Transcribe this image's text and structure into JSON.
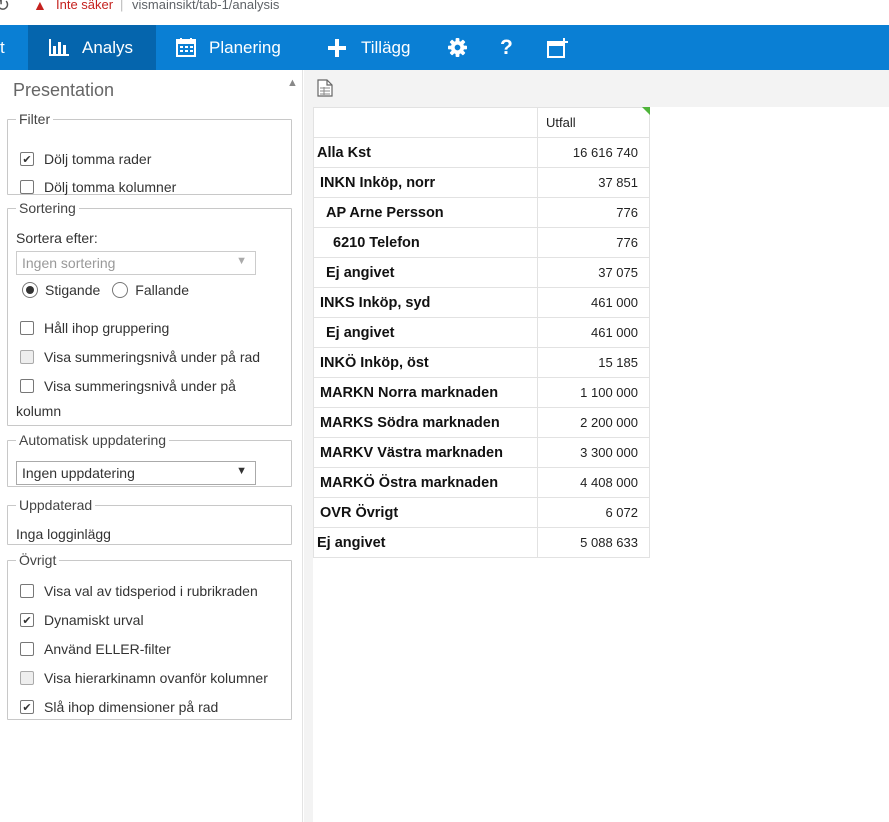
{
  "browser": {
    "security_label": "Inte säker",
    "url": "vismainsikt/tab-1/analysis"
  },
  "nav": {
    "items": [
      {
        "label": "Analys",
        "icon": "bar-chart-icon",
        "active": true
      },
      {
        "label": "Planering",
        "icon": "calendar-icon",
        "active": false
      },
      {
        "label": "Tillägg",
        "icon": "plus-icon",
        "active": false
      }
    ],
    "edge_glyph": "t",
    "icons": [
      "gear-icon",
      "help-icon",
      "add-window-icon"
    ]
  },
  "sidebar": {
    "title": "Presentation",
    "filter": {
      "legend": "Filter",
      "options": [
        {
          "label": "Dölj tomma rader",
          "checked": true
        },
        {
          "label": "Dölj tomma kolumner",
          "checked": false
        }
      ]
    },
    "sorting": {
      "legend": "Sortering",
      "sort_by_label": "Sortera efter:",
      "sort_by_value": "Ingen sortering",
      "radio_ascending": "Stigande",
      "radio_descending": "Fallande",
      "selected": "Stigande",
      "keep_grouping": "Håll ihop gruppering",
      "sum_level_row": "Visa summeringsnivå under på rad",
      "sum_level_column_line1": "Visa summeringsnivå under på",
      "sum_level_column_line2": "kolumn"
    },
    "auto_update": {
      "legend": "Automatisk uppdatering",
      "value": "Ingen uppdatering"
    },
    "updated": {
      "legend": "Uppdaterad",
      "text": "Inga logginlägg"
    },
    "other": {
      "legend": "Övrigt",
      "options": [
        {
          "label": "Visa val av tidsperiod i rubrikraden",
          "checked": false
        },
        {
          "label": "Dynamiskt urval",
          "checked": true
        },
        {
          "label": "Använd ELLER-filter",
          "checked": false
        },
        {
          "label": "Visa hierarkinamn ovanför kolumner",
          "checked": false
        },
        {
          "label": "Slå ihop dimensioner på rad",
          "checked": true
        }
      ]
    }
  },
  "table": {
    "column_header": "Utfall",
    "rows": [
      {
        "label": "Alla Kst",
        "value": "16 616 740",
        "level": 0
      },
      {
        "label": "INKN Inköp, norr",
        "value": "37 851",
        "level": 1
      },
      {
        "label": "AP Arne Persson",
        "value": "776",
        "level": 2
      },
      {
        "label": "6210 Telefon",
        "value": "776",
        "level": 3
      },
      {
        "label": "Ej angivet",
        "value": "37 075",
        "level": 2
      },
      {
        "label": "INKS Inköp, syd",
        "value": "461 000",
        "level": 1
      },
      {
        "label": "Ej angivet",
        "value": "461 000",
        "level": 2
      },
      {
        "label": "INKÖ Inköp, öst",
        "value": "15 185",
        "level": 1
      },
      {
        "label": "MARKN Norra marknaden",
        "value": "1 100 000",
        "level": 1
      },
      {
        "label": "MARKS Södra marknaden",
        "value": "2 200 000",
        "level": 1
      },
      {
        "label": "MARKV Västra marknaden",
        "value": "3 300 000",
        "level": 1
      },
      {
        "label": "MARKÖ Östra marknaden",
        "value": "4 408 000",
        "level": 1
      },
      {
        "label": "OVR Övrigt",
        "value": "6 072",
        "level": 1
      },
      {
        "label": "Ej angivet",
        "value": "5 088 633",
        "level": 0
      }
    ]
  },
  "colors": {
    "nav_bg": "#0a7fd4",
    "nav_active_bg": "#0565ad",
    "warning_red": "#c5221f",
    "corner_marker": "#4fb43a"
  }
}
